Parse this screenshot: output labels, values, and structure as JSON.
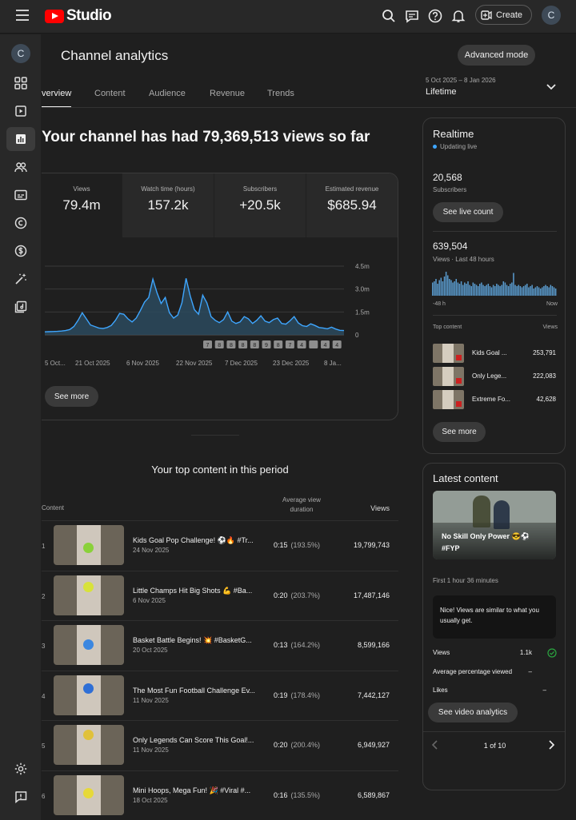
{
  "header": {
    "logo_text": "Studio",
    "create_label": "Create",
    "avatar_letter": "C"
  },
  "sidebar": {
    "avatar_letter": "C",
    "items": [
      {
        "name": "dashboard",
        "icon": "dashboard-icon"
      },
      {
        "name": "content",
        "icon": "video-library-icon"
      },
      {
        "name": "analytics",
        "icon": "analytics-icon",
        "active": true
      },
      {
        "name": "community",
        "icon": "people-icon"
      },
      {
        "name": "subtitles",
        "icon": "subtitles-icon"
      },
      {
        "name": "copyright",
        "icon": "copyright-icon"
      },
      {
        "name": "earn",
        "icon": "dollar-icon"
      },
      {
        "name": "customization",
        "icon": "magic-wand-icon"
      },
      {
        "name": "audio-library",
        "icon": "audio-library-icon"
      }
    ],
    "bottom": [
      {
        "name": "settings",
        "icon": "gear-icon"
      },
      {
        "name": "feedback",
        "icon": "feedback-icon"
      }
    ]
  },
  "page": {
    "title": "Channel analytics",
    "advanced_mode": "Advanced mode",
    "tabs": [
      {
        "label": "verview",
        "active": true
      },
      {
        "label": "Content"
      },
      {
        "label": "Audience"
      },
      {
        "label": "Revenue"
      },
      {
        "label": "Trends"
      }
    ],
    "date_range": "5 Oct 2025 – 8 Jan 2026",
    "period": "Lifetime",
    "headline": "Your channel has had 79,369,513 views so far"
  },
  "metrics": [
    {
      "label": "Views",
      "value": "79.4m"
    },
    {
      "label": "Watch time (hours)",
      "value": "157.2k"
    },
    {
      "label": "Subscribers",
      "value": "+20.5k"
    },
    {
      "label": "Estimated revenue",
      "value": "$685.94"
    }
  ],
  "chart_data": {
    "type": "area",
    "series_color": "#3ea6ff",
    "x_ticks": [
      "5 Oct...",
      "21 Oct 2025",
      "6 Nov 2025",
      "22 Nov 2025",
      "7 Dec 2025",
      "23 Dec 2025",
      "8 Ja..."
    ],
    "y_ticks": [
      "4.5m",
      "3.0m",
      "1.5m",
      "0"
    ],
    "ylim": [
      0,
      4500000
    ],
    "marker_labels": [
      "7",
      "8",
      "8",
      "8",
      "8",
      "9",
      "8",
      "7",
      "4",
      "",
      "4",
      "4"
    ],
    "values": [
      0.2,
      0.21,
      0.22,
      0.23,
      0.25,
      0.28,
      0.35,
      0.55,
      0.95,
      1.45,
      1.05,
      0.65,
      0.55,
      0.45,
      0.42,
      0.48,
      0.62,
      0.95,
      1.4,
      1.35,
      1.05,
      0.85,
      1.1,
      1.6,
      2.15,
      2.45,
      3.65,
      2.75,
      2.05,
      2.45,
      1.45,
      1.1,
      1.3,
      2.1,
      3.7,
      2.55,
      1.65,
      1.35,
      2.6,
      2.1,
      1.2,
      0.95,
      0.8,
      1.0,
      1.5,
      0.9,
      0.75,
      0.85,
      1.2,
      1.05,
      0.75,
      0.95,
      1.25,
      0.9,
      0.8,
      1.0,
      1.1,
      0.75,
      0.7,
      0.92,
      1.2,
      0.78,
      0.6,
      0.55,
      0.72,
      0.62,
      0.48,
      0.45,
      0.4,
      0.5,
      0.38,
      0.3,
      0.28
    ]
  },
  "overview": {
    "see_more": "See more"
  },
  "top_content": {
    "title": "Your top content in this period",
    "col_content": "Content",
    "col_avd": "Average view duration",
    "col_views": "Views",
    "rows": [
      {
        "rank": "1",
        "title": "Kids Goal Pop Challenge! ⚽🔥 #Tr...",
        "date": "24 Nov 2025",
        "avd": "0:15",
        "pct": "(193.5%)",
        "views": "19,799,743",
        "ball": "#8ad13a"
      },
      {
        "rank": "2",
        "title": "Little Champs Hit Big Shots 💪 #Ba...",
        "date": "6 Nov 2025",
        "avd": "0:20",
        "pct": "(203.7%)",
        "views": "17,487,146",
        "ball": "#d8e23a"
      },
      {
        "rank": "3",
        "title": "Basket Battle Begins! 💥 #BasketG...",
        "date": "20 Oct 2025",
        "avd": "0:13",
        "pct": "(164.2%)",
        "views": "8,599,166",
        "ball": "#3b87e0"
      },
      {
        "rank": "4",
        "title": "The Most Fun Football Challenge Ev...",
        "date": "11 Nov 2025",
        "avd": "0:19",
        "pct": "(178.4%)",
        "views": "7,442,127",
        "ball": "#2f6fd6"
      },
      {
        "rank": "5",
        "title": "Only Legends Can Score This Goal!...",
        "date": "11 Nov 2025",
        "avd": "0:20",
        "pct": "(200.4%)",
        "views": "6,949,927",
        "ball": "#e0c13a"
      },
      {
        "rank": "6",
        "title": "Mini Hoops, Mega Fun! 🎉 #Viral #...",
        "date": "18 Oct 2025",
        "avd": "0:16",
        "pct": "(135.5%)",
        "views": "6,589,867",
        "ball": "#e6d93a"
      }
    ]
  },
  "realtime": {
    "title": "Realtime",
    "status": "Updating live",
    "subscribers": "20,568",
    "subscribers_label": "Subscribers",
    "live_count_btn": "See live count",
    "views": "639,504",
    "views_label": "Views · Last 48 hours",
    "axis_left": "-48 h",
    "axis_right": "Now",
    "top_label": "Top content",
    "views_col": "Views",
    "bars": [
      0.55,
      0.6,
      0.7,
      0.5,
      0.65,
      0.75,
      0.6,
      0.8,
      1.0,
      0.85,
      0.7,
      0.65,
      0.55,
      0.6,
      0.7,
      0.55,
      0.5,
      0.6,
      0.45,
      0.55,
      0.5,
      0.6,
      0.45,
      0.4,
      0.55,
      0.5,
      0.45,
      0.4,
      0.5,
      0.55,
      0.45,
      0.4,
      0.45,
      0.5,
      0.4,
      0.35,
      0.45,
      0.4,
      0.5,
      0.45,
      0.4,
      0.45,
      0.6,
      0.55,
      0.45,
      0.4,
      0.5,
      0.55,
      0.95,
      0.45,
      0.4,
      0.45,
      0.4,
      0.35,
      0.4,
      0.45,
      0.5,
      0.35,
      0.4,
      0.45,
      0.3,
      0.35,
      0.4,
      0.35,
      0.3,
      0.35,
      0.4,
      0.45,
      0.4,
      0.35,
      0.45,
      0.4,
      0.35,
      0.3
    ],
    "top": [
      {
        "name": "Kids Goal ...",
        "views": "253,791"
      },
      {
        "name": "Only Lege...",
        "views": "222,083"
      },
      {
        "name": "Extreme Fo...",
        "views": "42,628"
      }
    ],
    "see_more": "See more"
  },
  "latest": {
    "title": "Latest content",
    "thumb_title": "No Skill Only Power 😎⚽ #FYP",
    "since": "First 1 hour 36 minutes",
    "note": "Nice! Views are similar to what you usually get.",
    "stats": [
      {
        "label": "Views",
        "value": "1.1k"
      },
      {
        "label": "Average percentage viewed",
        "value": "–"
      },
      {
        "label": "Likes",
        "value": "–"
      }
    ],
    "btn": "See video analytics",
    "pager": "1 of 10"
  }
}
